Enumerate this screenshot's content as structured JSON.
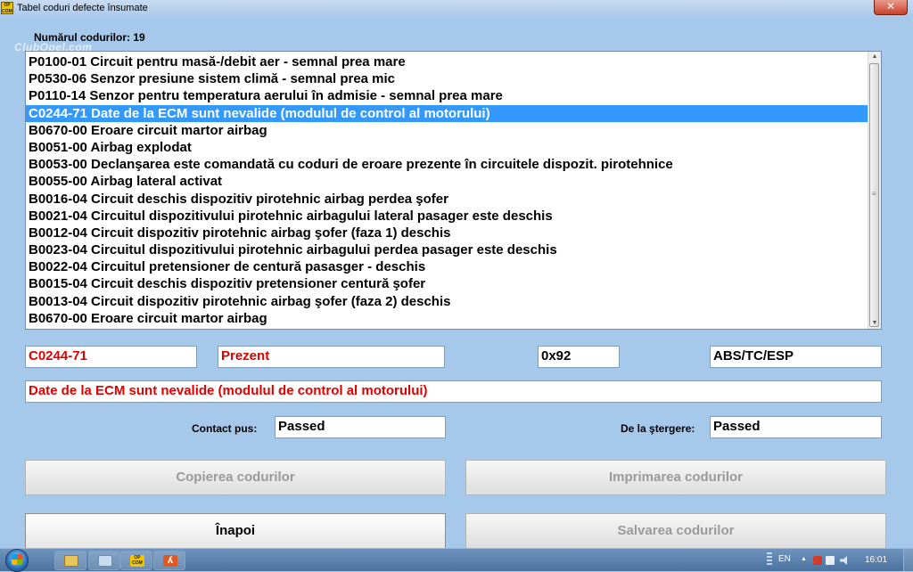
{
  "window": {
    "title": "Tabel  coduri defecte însumate",
    "close_label": "✕",
    "app_icon_text": "OP COM"
  },
  "watermark": "ClubOpel.com",
  "count_label": "Numărul codurilor: 19",
  "codes": [
    "P0100-01 Circuit pentru masă-/debit aer - semnal prea mare",
    "P0530-06 Senzor presiune sistem climă - semnal prea mic",
    "P0110-14 Senzor pentru temperatura aerului în admisie - semnal prea mare",
    "C0244-71 Date de la ECM sunt nevalide (modulul de control al motorului)",
    "B0670-00 Eroare circuit martor airbag",
    "B0051-00 Airbag explodat",
    "B0053-00 Declanşarea este comandată cu coduri de eroare prezente în circuitele dispozit. pirotehnice",
    "B0055-00 Airbag lateral activat",
    "B0016-04 Circuit  deschis dispozitiv pirotehnic airbag perdea şofer",
    "B0021-04 Circuitul dispozitivului pirotehnic airbagului lateral pasager este deschis",
    "B0012-04 Circuit dispozitiv pirotehnic airbag şofer (faza 1) deschis",
    "B0023-04 Circuitul dispozitivului pirotehnic airbagului perdea pasager este deschis",
    "B0022-04 Circuitul pretensioner de centură pasasger - deschis",
    "B0015-04 Circuit deschis dispozitiv pretensioner centură şofer",
    "B0013-04 Circuit dispozitiv pirotehnic airbag şofer (faza 2) deschis",
    "B0670-00 Eroare circuit martor airbag"
  ],
  "selected_index": 3,
  "detail": {
    "code": "C0244-71",
    "status": "Prezent",
    "hex": "0x92",
    "module": "ABS/TC/ESP",
    "description": "Date de la ECM sunt nevalide (modulul de control al motorului)",
    "contact_label": "Contact pus:",
    "contact_value": "Passed",
    "erase_label": "De la ştergere:",
    "erase_value": "Passed"
  },
  "buttons": {
    "copy": "Copierea codurilor",
    "print": "Imprimarea codurilor",
    "back": "Înapoi",
    "save": "Salvarea codurilor"
  },
  "taskbar": {
    "lang": "EN",
    "clock": "16:01",
    "opcom_icon_text": "OP COM"
  },
  "colors": {
    "selection": "#3399ff",
    "error_text": "#e00000",
    "background": "#a6c8ea"
  }
}
